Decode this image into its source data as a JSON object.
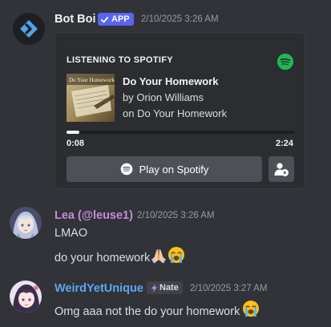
{
  "messages": {
    "bot": {
      "username": "Bot Boi",
      "badge": "APP",
      "timestamp": "2/10/2025 3:26 AM",
      "embed": {
        "header": "LISTENING TO SPOTIFY",
        "album_art_text": "Do Your Homework",
        "song_title": "Do Your Homework",
        "artist_line": "by Orion Williams",
        "album_line": "on Do Your Homework",
        "elapsed": "0:08",
        "duration": "2:24",
        "progress_fraction": 0.056,
        "play_button": "Play on Spotify"
      }
    },
    "lea": {
      "username": "Lea (@leuse1)",
      "timestamp": "2/10/2025 3:26 AM",
      "lines": [
        "LMAO",
        "do your homework"
      ]
    },
    "weird": {
      "username": "WeirdYetUnique",
      "tag": "Nate",
      "timestamp": "2/10/2025 3:27 AM",
      "text": "Omg aaa not the do your homework"
    }
  },
  "colors": {
    "background": "#313338",
    "app_badge": "#5865f2",
    "spotify_green": "#1db954",
    "lea_name": "#c38bdc",
    "weird_name": "#5ca7f0"
  },
  "icons": {
    "checkmark": "check-icon",
    "spotify": "spotify-icon",
    "profile": "user-profile-icon",
    "praying_hands": "praying-hands-emoji",
    "sob": "loudly-crying-emoji",
    "sparkle": "sparkle-icon"
  }
}
